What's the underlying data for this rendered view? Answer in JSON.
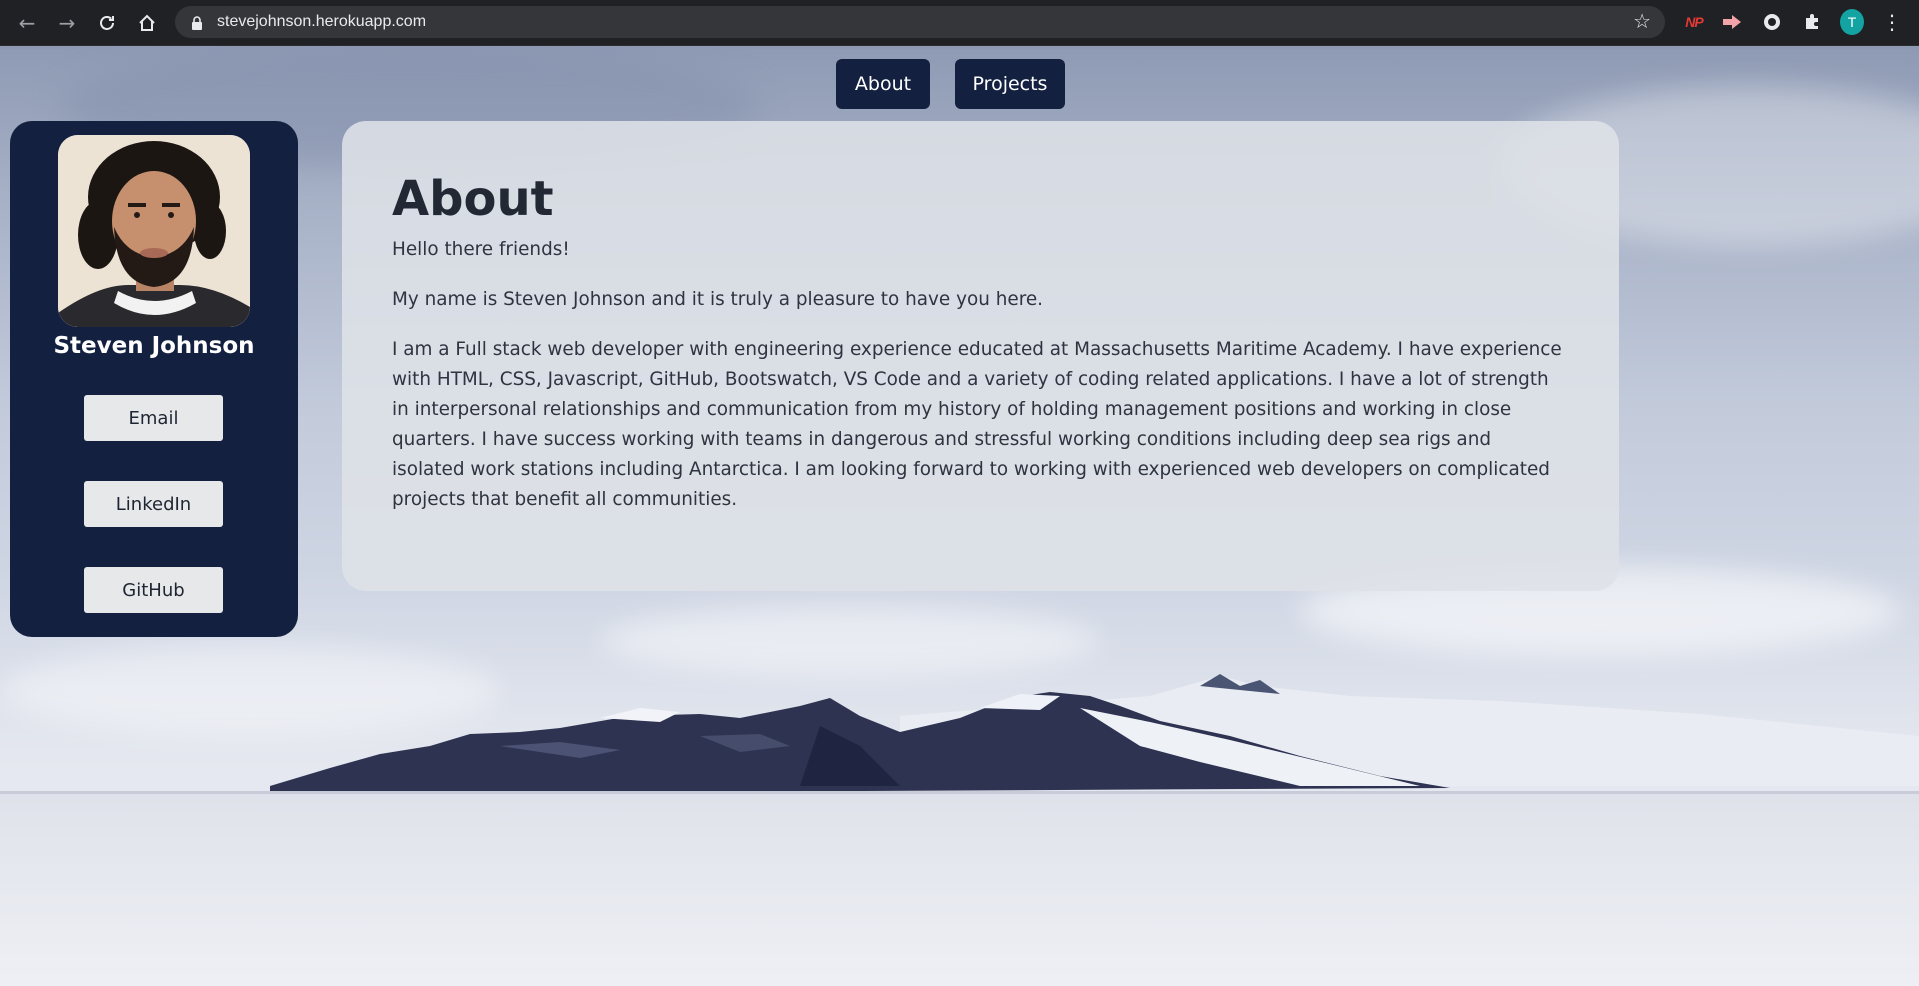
{
  "browser": {
    "url": "stevejohnson.herokuapp.com",
    "profile_initial": "T",
    "extension_np_label": "NP"
  },
  "nav": {
    "about_label": "About",
    "projects_label": "Projects"
  },
  "sidebar": {
    "name": "Steven Johnson",
    "buttons": [
      "Email",
      "LinkedIn",
      "GitHub"
    ]
  },
  "about": {
    "title": "About",
    "paragraphs": [
      "Hello there friends!",
      "My name is Steven Johnson and it is truly a pleasure to have you here.",
      "I am a Full stack web developer with engineering experience educated at Massachusetts Maritime Academy. I have experience with HTML, CSS, Javascript, GitHub, Bootswatch, VS Code and a variety of coding related applications. I have a lot of strength in interpersonal relationships and communication from my history of holding management positions and working in close quarters. I have success working with teams in dangerous and stressful working conditions including deep sea rigs and isolated work stations including Antarctica. I am looking forward to working with experienced web developers on complicated projects that benefit all communities."
    ]
  },
  "colors": {
    "navy": "#132040",
    "card": "#dee1e7",
    "button": "#e7e8ea"
  }
}
